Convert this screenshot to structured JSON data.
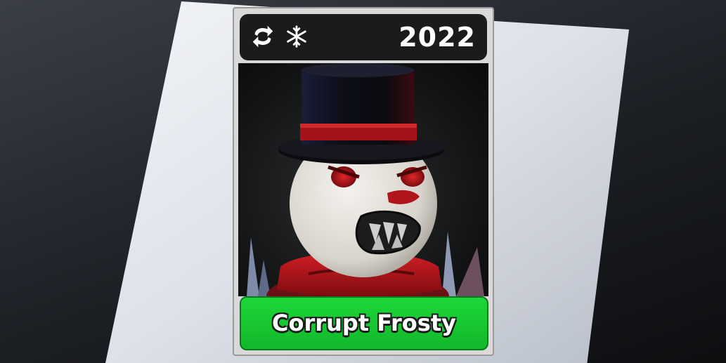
{
  "card": {
    "year": "2022",
    "name": "Corrupt Frosty",
    "icons": [
      "trade-icon",
      "snowflake-icon"
    ],
    "name_bar_color": "#16c630",
    "header_color": "#1b1b1b"
  }
}
